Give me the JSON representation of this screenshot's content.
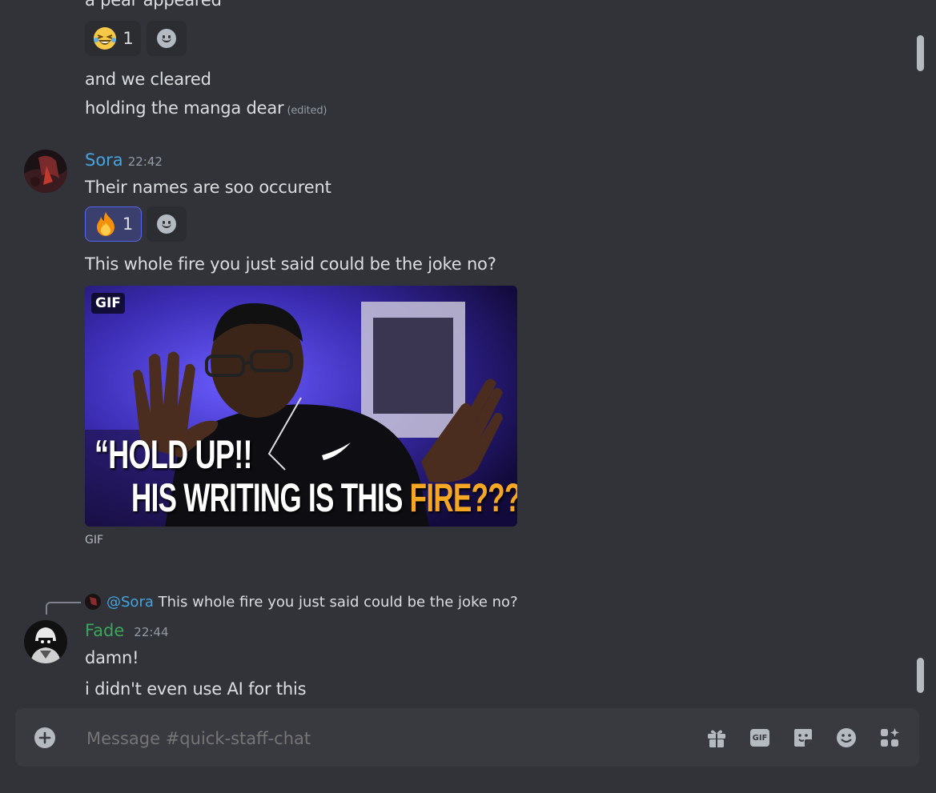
{
  "messages_top": {
    "line1": "a pear appeared",
    "reaction_count": "1",
    "line2": "and we cleared",
    "line3": "holding the manga dear",
    "edited_label": "(edited)"
  },
  "sora_message": {
    "username": "Sora",
    "username_color": "#45a4df",
    "time": "22:42",
    "text": "Their names are soo occurent",
    "reaction_emoji": "fire",
    "reaction_count": "1",
    "text2": "This whole fire you just said could be the joke no?",
    "gif_badge": "GIF",
    "gif_caption_line1": "“HOLD UP!!",
    "gif_caption_line2a": "HIS WRITING IS THIS ",
    "gif_caption_line2b": "FIRE???”",
    "gif_label": "GIF"
  },
  "fade_message": {
    "reply_mention": "@Sora",
    "reply_text": "This whole fire you just said could be the joke no?",
    "username": "Fade",
    "username_color": "#3ba55c",
    "time": "22:44",
    "line1": "damn!",
    "line2": "i didn't even use AI for this"
  },
  "composer": {
    "placeholder": "Message #quick-staff-chat",
    "gif_button_label": "GIF",
    "icons": [
      "add-circle-icon",
      "gift-icon",
      "gif-icon",
      "sticker-icon",
      "emoji-icon",
      "apps-icon"
    ]
  },
  "colors": {
    "background": "#313338",
    "composer_bg": "#383a40",
    "reaction_active_border": "#5865f2",
    "fire_text": "#f5a623"
  }
}
